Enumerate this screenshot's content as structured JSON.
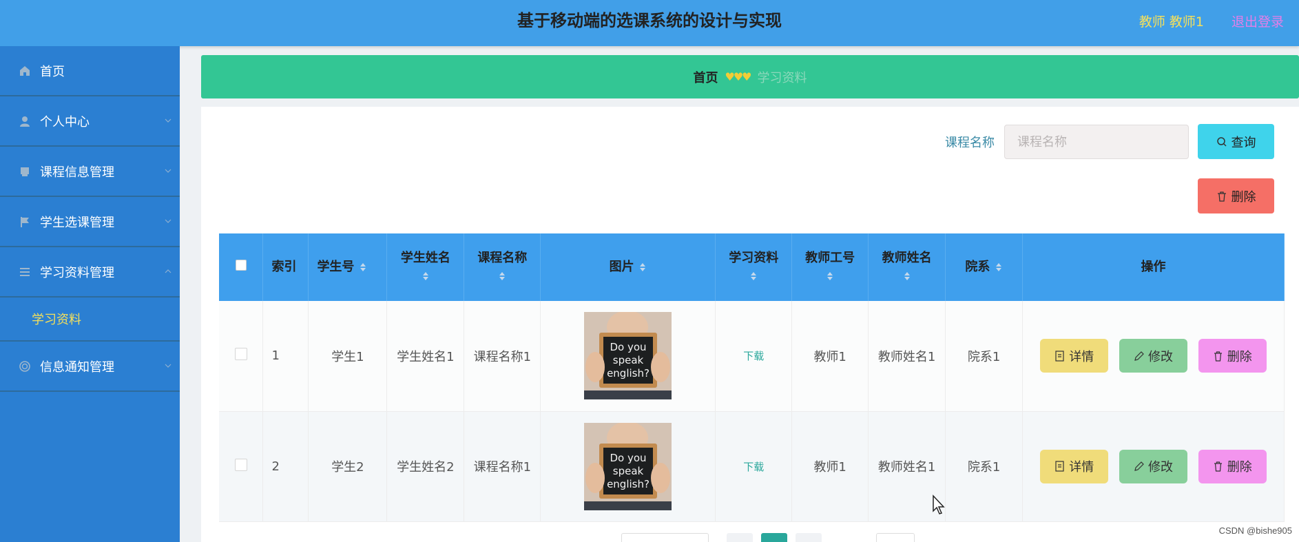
{
  "header": {
    "title": "基于移动端的选课系统的设计与实现",
    "user": "教师 教师1",
    "logout": "退出登录"
  },
  "sidebar": {
    "items": [
      {
        "label": "首页",
        "icon": "home-icon"
      },
      {
        "label": "个人中心",
        "icon": "user-icon"
      },
      {
        "label": "课程信息管理",
        "icon": "book-icon"
      },
      {
        "label": "学生选课管理",
        "icon": "flag-icon"
      },
      {
        "label": "学习资料管理",
        "icon": "list-icon"
      },
      {
        "label": "信息通知管理",
        "icon": "notification-icon"
      }
    ],
    "sub_item": "学习资料"
  },
  "breadcrumb": {
    "home": "首页",
    "separator": "♥♥♥",
    "current": "学习资料"
  },
  "search": {
    "label": "课程名称",
    "placeholder": "课程名称",
    "button": "查询"
  },
  "toolbar": {
    "delete": "删除"
  },
  "table": {
    "headers": [
      "索引",
      "学生号",
      "学生姓名",
      "课程名称",
      "图片",
      "学习资料",
      "教师工号",
      "教师姓名",
      "院系",
      "操作"
    ],
    "rows": [
      {
        "index": "1",
        "student_no": "学生1",
        "student_name": "学生姓名1",
        "course": "课程名称1",
        "image_text": "Do you speak english?",
        "material": "下载",
        "teacher_no": "教师1",
        "teacher_name": "教师姓名1",
        "dept": "院系1"
      },
      {
        "index": "2",
        "student_no": "学生2",
        "student_name": "学生姓名2",
        "course": "课程名称1",
        "image_text": "Do you speak english?",
        "material": "下载",
        "teacher_no": "教师1",
        "teacher_name": "教师姓名1",
        "dept": "院系1"
      }
    ],
    "actions": {
      "detail": "详情",
      "edit": "修改",
      "delete": "删除"
    }
  },
  "watermark": "CSDN @bishe905",
  "colors": {
    "header": "#419fe8",
    "sidebar": "#2b7fd2",
    "breadcrumb": "#33c694",
    "table_header": "#3f9fed",
    "query_button": "#3fd3eb",
    "delete_button": "#f56f66",
    "detail_button": "#f0dc7a",
    "edit_button": "#88cf9b",
    "row_delete_button": "#f395ee"
  }
}
